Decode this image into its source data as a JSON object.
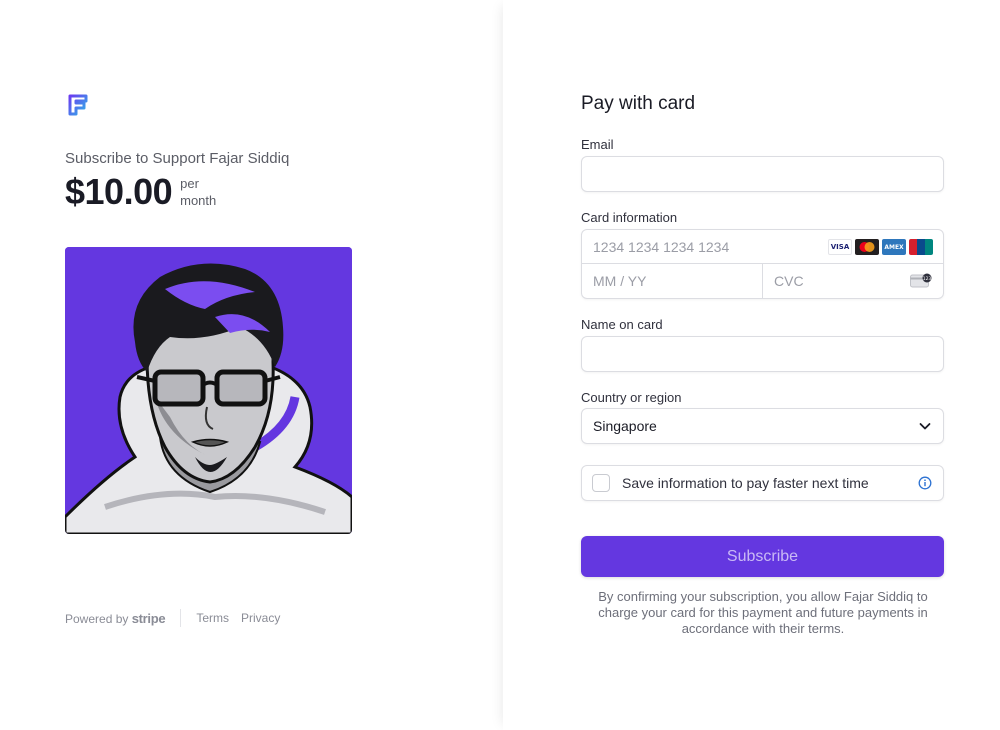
{
  "product": {
    "title": "Subscribe to Support Fajar Siddiq",
    "price": "$10.00",
    "period_line1": "per",
    "period_line2": "month"
  },
  "footer": {
    "powered_prefix": "Powered by",
    "powered_brand": "stripe",
    "terms": "Terms",
    "privacy": "Privacy"
  },
  "form": {
    "title": "Pay with card",
    "email_label": "Email",
    "email_value": "",
    "card_label": "Card information",
    "card_number_placeholder": "1234 1234 1234 1234",
    "expiry_placeholder": "MM / YY",
    "cvc_placeholder": "CVC",
    "card_brands": [
      "VISA",
      "mastercard",
      "AMEX",
      "UnionPay"
    ],
    "name_label": "Name on card",
    "name_value": "",
    "country_label": "Country or region",
    "country_value": "Singapore",
    "save_label": "Save information to pay faster next time",
    "save_checked": false,
    "submit_label": "Subscribe",
    "terms_text": "By confirming your subscription, you allow Fajar Siddiq to charge your card for this payment and future payments in accordance with their terms."
  },
  "colors": {
    "accent": "#6437e0",
    "button_text": "#c9b9f5"
  },
  "icons": {
    "logo": "brand-logo-icon",
    "chevron": "chevron-down-icon",
    "info": "info-icon",
    "cvc": "cvc-card-icon"
  }
}
